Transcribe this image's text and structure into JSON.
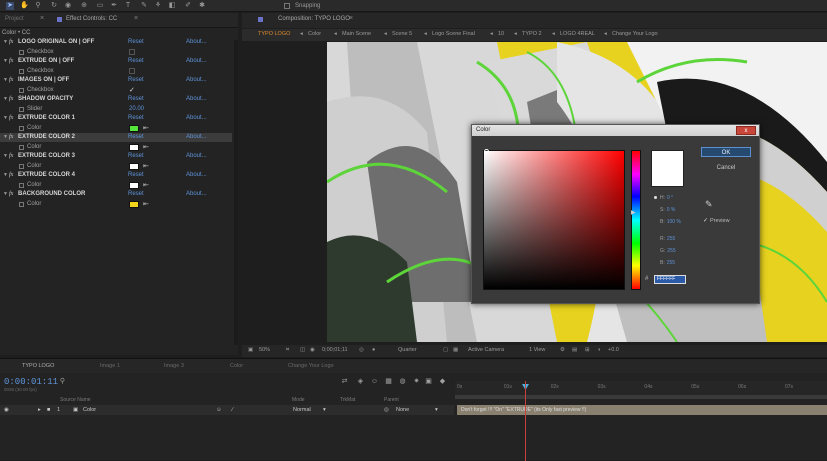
{
  "toolbar": {
    "snapping_label": "Snapping"
  },
  "project_panel": {
    "tabs": [
      {
        "label": "Project"
      },
      {
        "label": "Effect Controls: CC"
      }
    ],
    "header": "Color • CC",
    "effects": [
      {
        "name": "LOGO ORIGINAL  ON | OFF",
        "reset": "Reset",
        "about": "About...",
        "sub": {
          "label": "Checkbox",
          "type": "checkbox",
          "checked": false
        }
      },
      {
        "name": "EXTRUDE  ON | OFF",
        "reset": "Reset",
        "about": "About...",
        "sub": {
          "label": "Checkbox",
          "type": "checkbox",
          "checked": false
        }
      },
      {
        "name": "IMAGES  ON | OFF",
        "reset": "Reset",
        "about": "About...",
        "sub": {
          "label": "Checkbox",
          "type": "checkbox",
          "checked": true
        }
      },
      {
        "name": "SHADOW OPACITY",
        "reset": "Reset",
        "about": "About...",
        "sub": {
          "label": "Slider",
          "type": "slider",
          "value": "20.00"
        }
      },
      {
        "name": "EXTRUDE COLOR 1",
        "reset": "Reset",
        "about": "About...",
        "sub": {
          "label": "Color",
          "type": "color",
          "color": "#55e63c"
        }
      },
      {
        "name": "EXTRUDE COLOR 2",
        "reset": "Reset",
        "about": "About...",
        "highlight": true,
        "sub": {
          "label": "Color",
          "type": "color",
          "color": "#ffffff"
        }
      },
      {
        "name": "EXTRUDE COLOR 3",
        "reset": "Reset",
        "about": "About...",
        "sub": {
          "label": "Color",
          "type": "color",
          "color": "#ffffff"
        }
      },
      {
        "name": "EXTRUDE COLOR 4",
        "reset": "Reset",
        "about": "About...",
        "sub": {
          "label": "Color",
          "type": "color",
          "color": "#ffffff"
        }
      },
      {
        "name": "BACKGROUND COLOR",
        "reset": "Reset",
        "about": "About...",
        "sub": {
          "label": "Color",
          "type": "color",
          "color": "#f2d41a"
        }
      }
    ]
  },
  "composition": {
    "tab_label": "Composition: TYPO LOGO",
    "breadcrumbs": [
      "TYPO LOGO",
      "Color",
      "Main Scene",
      "Scene 5",
      "Logo Scene Final",
      "10",
      "TYPO 2",
      "LOGO 4REAL",
      "Change Your Logo"
    ],
    "status": {
      "zoom": "50%",
      "time": "0;00;01;11",
      "resolution": "Quarter",
      "camera": "Active Camera",
      "view": "1 View",
      "exposure": "+0.0"
    }
  },
  "color_dialog": {
    "title": "Color",
    "close_label": "x",
    "ok_label": "OK",
    "cancel_label": "Cancel",
    "preview_label": "Preview",
    "preview_checked": "✓",
    "hex_hash": "#",
    "hex_value": "FFFFFF",
    "channels": [
      {
        "label": "H:",
        "value": "0 °",
        "selected": true
      },
      {
        "label": "S:",
        "value": "0 %"
      },
      {
        "label": "B:",
        "value": "100 %"
      },
      {
        "label": "R:",
        "value": "255"
      },
      {
        "label": "G:",
        "value": "255"
      },
      {
        "label": "B:",
        "value": "255"
      }
    ],
    "current_color": "#ffffff"
  },
  "timeline": {
    "tabs": [
      {
        "label": "TYPO LOGO"
      },
      {
        "label": "Image 1"
      },
      {
        "label": "Image 3"
      },
      {
        "label": "Color"
      },
      {
        "label": "Change Your Logo"
      }
    ],
    "timecode": "0:00:01:11",
    "frames": "0035 (30.00 fps)",
    "columns": {
      "source": "Source Name",
      "mode": "Mode",
      "trkmat": "TrkMat",
      "parent": "Parent"
    },
    "layer": {
      "index": "1",
      "name": "Color",
      "mode": "Normal",
      "parent": "None"
    },
    "ruler_ticks": [
      "0s",
      "01s",
      "02s",
      "03s",
      "04s",
      "05s",
      "06s",
      "07s"
    ],
    "layer_bar_text": "Don't forget !!! \"On\" \"EXTRUDE\" (its Only fast preview !!)"
  }
}
